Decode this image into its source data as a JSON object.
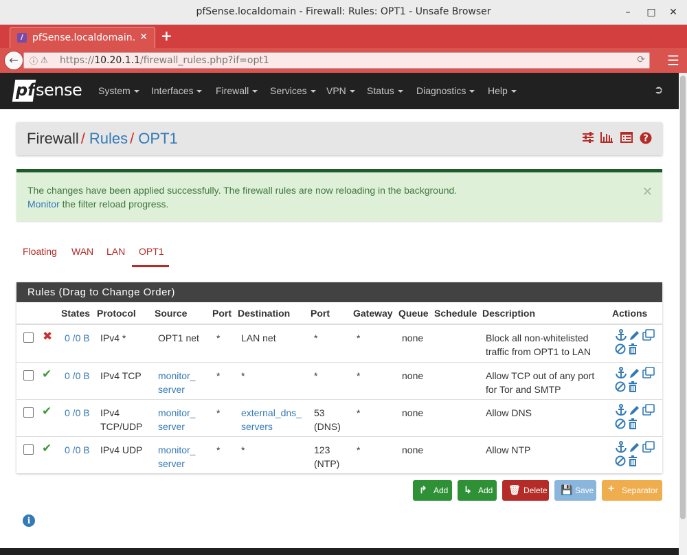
{
  "window": {
    "title": "pfSense.localdomain - Firewall: Rules: OPT1 - Unsafe Browser"
  },
  "browser": {
    "tab_title": "pfSense.localdomain...",
    "url_prefix": "https://",
    "url_host": "10.20.1.1",
    "url_path": "/firewall_rules.php?if=opt1"
  },
  "nav": {
    "items": [
      "System",
      "Interfaces",
      "Firewall",
      "Services",
      "VPN",
      "Status",
      "Diagnostics",
      "Help"
    ]
  },
  "breadcrumb": {
    "root": "Firewall",
    "middle": "Rules",
    "current": "OPT1"
  },
  "alert": {
    "line1": "The changes have been applied successfully. The firewall rules are now reloading in the background.",
    "link": "Monitor",
    "line2_rest": " the filter reload progress."
  },
  "tabs": [
    "Floating",
    "WAN",
    "LAN",
    "OPT1"
  ],
  "rules": {
    "panel_title": "Rules (Drag to Change Order)",
    "headers": [
      "States",
      "Protocol",
      "Source",
      "Port",
      "Destination",
      "Port",
      "Gateway",
      "Queue",
      "Schedule",
      "Description",
      "Actions"
    ],
    "rows": [
      {
        "status": "block",
        "states": "0 /0 B",
        "protocol": [
          "IPv4 *"
        ],
        "source": [
          "OPT1 net"
        ],
        "source_link": false,
        "src_port": "*",
        "destination": [
          "LAN net"
        ],
        "dest_link": false,
        "dest_port": [
          "*"
        ],
        "gateway": "*",
        "queue": "none",
        "description": [
          "Block all non-whitelisted",
          "traffic from OPT1 to LAN"
        ]
      },
      {
        "status": "pass",
        "states": "0 /0 B",
        "protocol": [
          "IPv4 TCP"
        ],
        "source": [
          "monitor_",
          "server"
        ],
        "source_link": true,
        "src_port": "*",
        "destination": [
          "*"
        ],
        "dest_link": false,
        "dest_port": [
          "*"
        ],
        "gateway": "*",
        "queue": "none",
        "description": [
          "Allow TCP out of any port",
          "for Tor and SMTP"
        ]
      },
      {
        "status": "pass",
        "states": "0 /0 B",
        "protocol": [
          "IPv4",
          "TCP/UDP"
        ],
        "source": [
          "monitor_",
          "server"
        ],
        "source_link": true,
        "src_port": "*",
        "destination": [
          "external_dns_",
          "servers"
        ],
        "dest_link": true,
        "dest_port": [
          "53",
          "(DNS)"
        ],
        "gateway": "*",
        "queue": "none",
        "description": [
          "Allow DNS"
        ]
      },
      {
        "status": "pass",
        "states": "0 /0 B",
        "protocol": [
          "IPv4 UDP"
        ],
        "source": [
          "monitor_",
          "server"
        ],
        "source_link": true,
        "src_port": "*",
        "destination": [
          "*"
        ],
        "dest_link": false,
        "dest_port": [
          "123",
          "(NTP)"
        ],
        "gateway": "*",
        "queue": "none",
        "description": [
          "Allow NTP"
        ]
      }
    ]
  },
  "buttons": {
    "add_top": "Add",
    "add_bottom": "Add",
    "delete": "Delete",
    "save": "Save",
    "separator": "Separator"
  },
  "colors": {
    "brand_red": "#b52b27",
    "link_blue": "#337ab7",
    "success_green": "#3c763d",
    "nav_dark": "#212121"
  }
}
